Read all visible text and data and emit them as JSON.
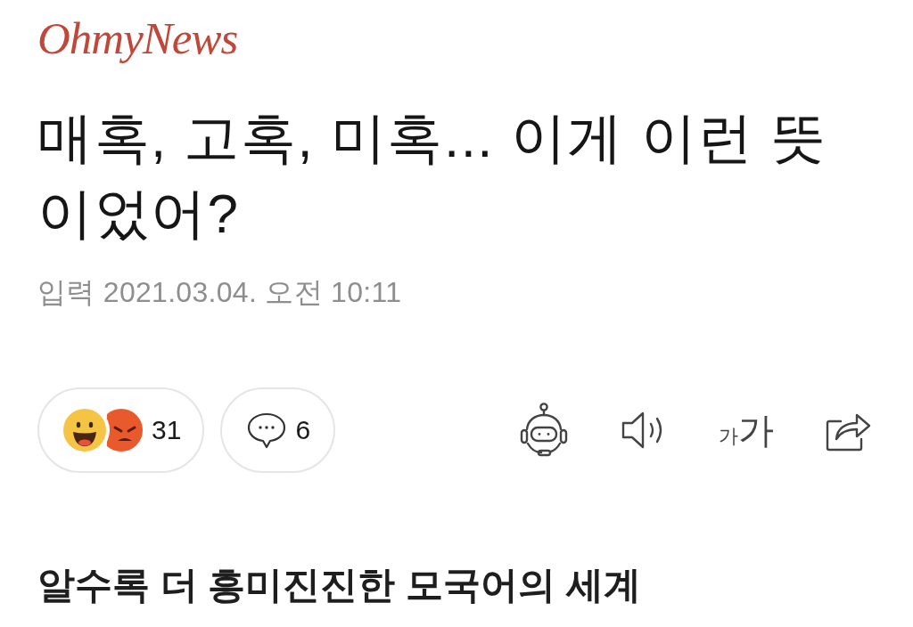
{
  "logo": {
    "text": "OhmyNews"
  },
  "article": {
    "title": "매혹, 고혹, 미혹... 이게 이런 뜻이었어?",
    "published": "입력 2021.03.04. 오전 10:11"
  },
  "reactions": {
    "emojis": [
      {
        "kind": "laugh"
      },
      {
        "kind": "angry"
      }
    ],
    "count": "31"
  },
  "comments": {
    "count": "6"
  },
  "tools": [
    {
      "kind": "robot"
    },
    {
      "kind": "speaker"
    },
    {
      "kind": "font_size",
      "small_label": "가",
      "large_label": "가"
    },
    {
      "kind": "share"
    }
  ],
  "subheading": "알수록 더 흥미진진한 모국어의 세계"
}
